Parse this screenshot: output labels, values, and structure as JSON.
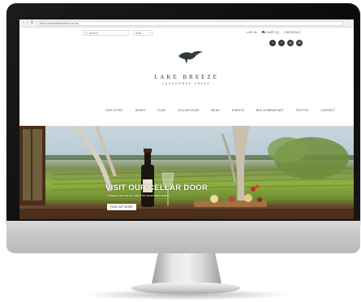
{
  "browser": {
    "url": "https://www.lakebreeze.com.au"
  },
  "header": {
    "search_placeholder": "Search",
    "currency": "AUD",
    "account": {
      "login": "LOG IN",
      "cart": "CART (0)",
      "checkout": "CHECKOUT"
    },
    "social": [
      {
        "icon": "twitter-icon",
        "glyph": "t"
      },
      {
        "icon": "facebook-icon",
        "glyph": "f"
      },
      {
        "icon": "instagram-icon",
        "glyph": "◎"
      },
      {
        "icon": "email-icon",
        "glyph": "✉"
      }
    ]
  },
  "brand": {
    "name": "LAKE BREEZE",
    "subtitle": "LANGHORNE CREEK"
  },
  "nav": {
    "items": [
      "OUR STORY",
      "WINES",
      "CLUB",
      "CELLAR DOOR",
      "MENU",
      "EVENTS",
      "BED & BREAKFAST",
      "PHOTOS",
      "CONTACT"
    ]
  },
  "hero": {
    "title": "VISIT OUR CELLAR DOOR",
    "subtitle": "Sample our wines, stay for lunch and more!",
    "cta": "FIND OUT MORE"
  },
  "colors": {
    "bezel": "#111111",
    "chin": "#c6c6c6",
    "social_bg": "#3a3a3a",
    "vineyard_green": "#8fb043",
    "bench_wood": "#5a3f28"
  }
}
